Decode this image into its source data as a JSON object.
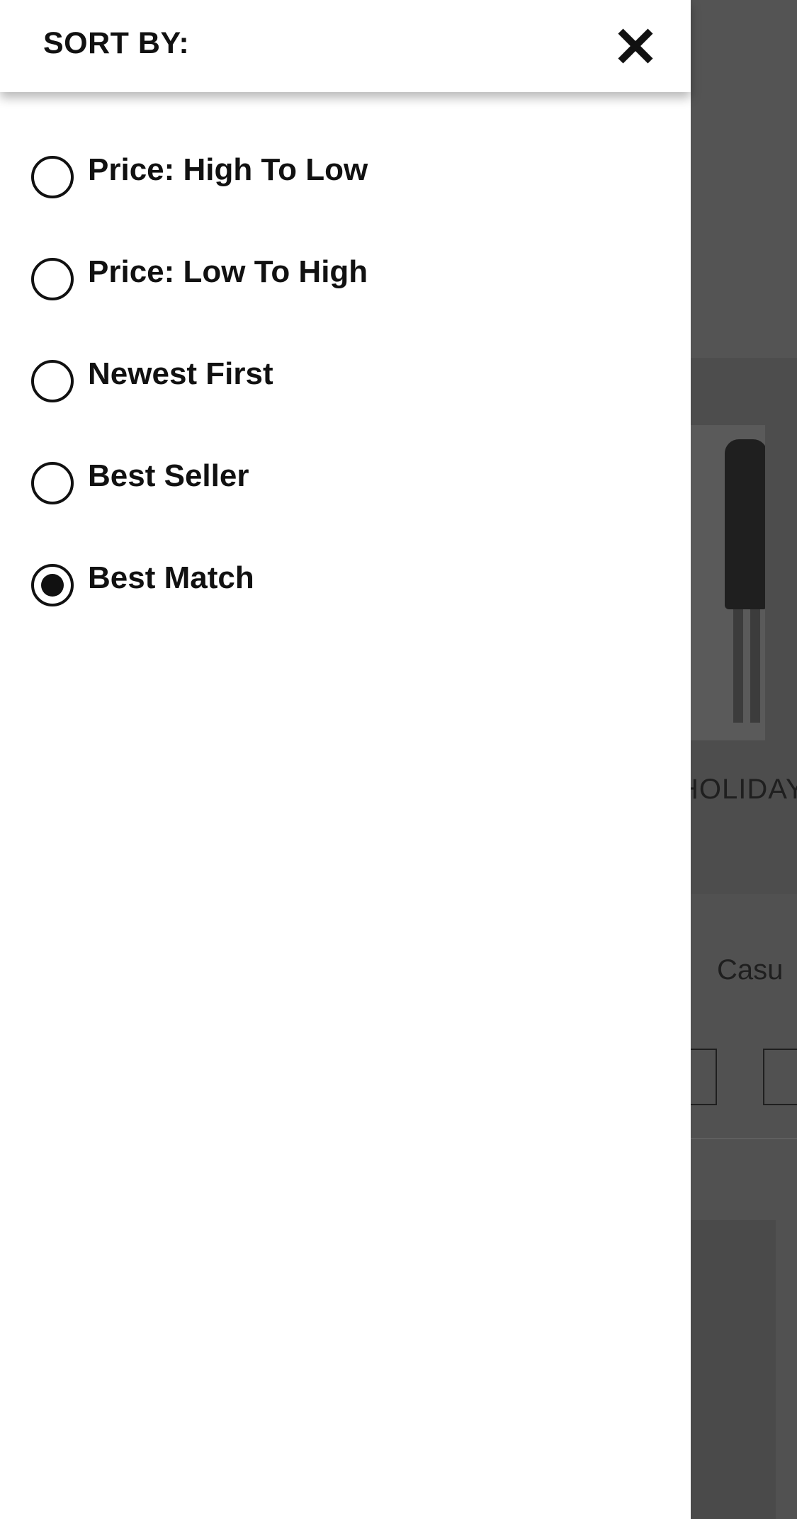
{
  "background": {
    "product_title_fragment": "HOLIDAY",
    "category_fragment": "Casu"
  },
  "sort_drawer": {
    "title": "SORT BY:",
    "close_icon": "close-icon",
    "selected_option": "Best Match",
    "options": [
      {
        "label": "Price: High To Low",
        "selected": false
      },
      {
        "label": "Price: Low To High",
        "selected": false
      },
      {
        "label": "Newest First",
        "selected": false
      },
      {
        "label": "Best Seller",
        "selected": false
      },
      {
        "label": "Best Match",
        "selected": true
      }
    ]
  }
}
